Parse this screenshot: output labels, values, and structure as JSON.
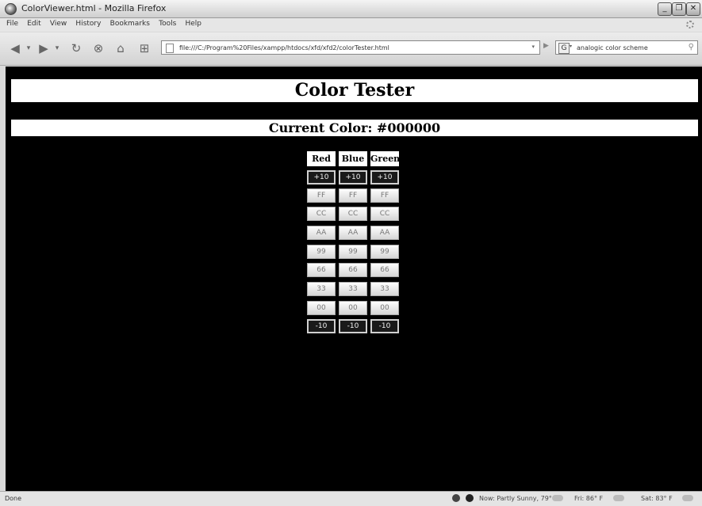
{
  "window": {
    "title": "ColorViewer.html - Mozilla Firefox",
    "controls": {
      "minimize": "_",
      "restore": "❐",
      "close": "✕"
    }
  },
  "menu": [
    "File",
    "Edit",
    "View",
    "History",
    "Bookmarks",
    "Tools",
    "Help"
  ],
  "nav": {
    "url": "file:///C:/Program%20Files/xampp/htdocs/xfd/xfd2/colorTester.html",
    "search_value": "analogic color scheme",
    "search_engine_icon": "G"
  },
  "page": {
    "title": "Color Tester",
    "current_color_text": "Current Color: #000000",
    "current_color": "#000000",
    "columns": [
      "Red",
      "Blue",
      "Green"
    ],
    "rows": [
      "+10",
      "FF",
      "CC",
      "AA",
      "99",
      "66",
      "33",
      "00",
      "-10"
    ]
  },
  "status": {
    "text": "Done",
    "weather_now": "Now: Partly Sunny, 79° F",
    "weather_fri": "Fri: 86° F",
    "weather_sat": "Sat: 83° F"
  },
  "colors": {
    "page_background": "#000000",
    "header_background": "#ffffff"
  }
}
